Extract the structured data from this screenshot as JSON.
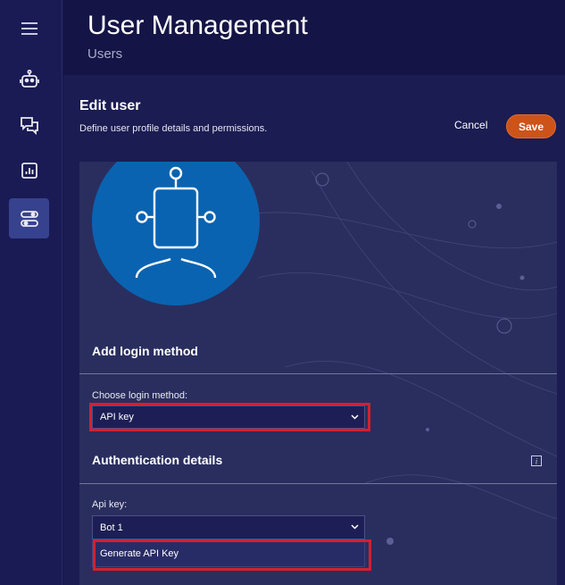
{
  "header": {
    "title": "User Management",
    "breadcrumb": "Users"
  },
  "sidebar": {
    "items": [
      {
        "icon": "menu-icon"
      },
      {
        "icon": "robot-icon"
      },
      {
        "icon": "chat-icon"
      },
      {
        "icon": "chart-icon"
      },
      {
        "icon": "settings-toggle-icon",
        "active": true
      }
    ]
  },
  "edit": {
    "title": "Edit user",
    "subtitle": "Define user profile details and permissions.",
    "cancel_label": "Cancel",
    "save_label": "Save"
  },
  "login": {
    "section_title": "Add login method",
    "label": "Choose login method:",
    "selected": "API key"
  },
  "auth": {
    "section_title": "Authentication details",
    "api_key_label": "Api key:",
    "api_key_selected": "Bot 1",
    "dropdown_option": "Generate API Key"
  },
  "colors": {
    "accent": "#cd5319",
    "highlight": "#d4202f",
    "avatar_blue": "#0a63b0"
  }
}
